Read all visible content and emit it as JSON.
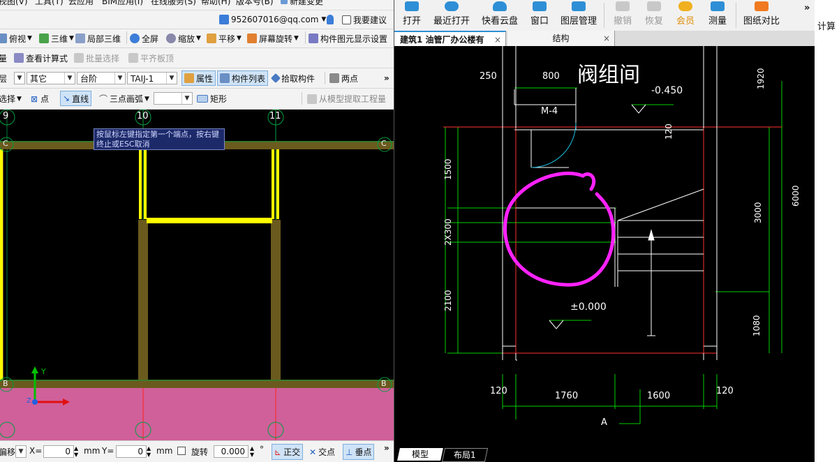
{
  "left_app": {
    "menu_items": [
      "视图(V)",
      "工具(T)",
      "云应用",
      "BIM应用(I)",
      "在线服务(S)",
      "帮助(H)",
      "版本号(B)",
      "新建变更"
    ],
    "user": {
      "email": "952607016@qq.com",
      "suggest": "我要建议"
    },
    "toolbar1": {
      "top_view": "俯视",
      "three_d": "三维",
      "partial_3d": "局部三维",
      "full_screen": "全屏",
      "zoom": "缩放",
      "pan": "平移",
      "screen_rotate": "屏幕旋转",
      "display_settings": "构件图元显示设置"
    },
    "toolbar2": {
      "quantity": "量",
      "view_formula": "查看计算式",
      "batch_select": "批量选择",
      "align_slab": "平齐板顶"
    },
    "toolbar3": {
      "floor": "层",
      "cat1": "其它",
      "cat2": "台阶",
      "cat3": "TAIJ-1",
      "properties": "属性",
      "component_list": "构件列表",
      "pick_component": "拾取构件",
      "two_points": "两点"
    },
    "toolbar4": {
      "select": "选择",
      "point": "点",
      "line": "直线",
      "arc": "三点画弧",
      "rect": "矩形",
      "extract": "从模型提取工程量"
    },
    "grid_labels_top": [
      "9",
      "10",
      "11"
    ],
    "grid_labels_side": [
      "C",
      "B"
    ],
    "tooltip": "按鼠标左键指定第一个端点，按右键终止或ESC取消",
    "axis": {
      "y": "Y",
      "z": "Z"
    },
    "status": {
      "move": "偏移",
      "x_label": "X=",
      "x_value": "0",
      "y_label": "Y=",
      "y_value": "0",
      "unit": "mm",
      "rotate": "旋转",
      "rotate_value": "0.000",
      "degree": "°",
      "ortho": "正交",
      "intersection": "交点",
      "perpendicular": "垂点"
    }
  },
  "right_app": {
    "toolbar": {
      "open": "打开",
      "recent": "最近打开",
      "cloud": "快看云盘",
      "window": "窗口",
      "layer_mgmt": "图层管理",
      "undo": "撤销",
      "redo": "恢复",
      "vip": "会员",
      "measure": "测量",
      "compare": "图纸对比"
    },
    "side_label": "计算",
    "tabs": [
      {
        "label": "建筑1 油管厂办公楼有",
        "active": true
      },
      {
        "label": "结构",
        "active": false
      }
    ],
    "drawing": {
      "room_title": "阀组间",
      "dims": {
        "d250": "250",
        "d800": "800",
        "door": "M-4",
        "elev1": "-0.450",
        "d120a": "120",
        "d1920": "1920",
        "d1500": "1500",
        "d2x300": "2X300",
        "d3000": "3000",
        "d6000": "6000",
        "d2100": "2100",
        "elev2": "±0.000",
        "d1080": "1080",
        "d120b": "120",
        "d1760": "1760",
        "d1600": "1600",
        "d120c": "120",
        "axisA": "A"
      }
    },
    "bottom_tabs": [
      "模型",
      "布局1"
    ]
  },
  "colors": {
    "highlight": "#ff22ff",
    "dim_green": "#00d000",
    "wall_red": "#ff3030",
    "beam_yellow": "#ffff00",
    "slab_pink": "#d0609a"
  }
}
